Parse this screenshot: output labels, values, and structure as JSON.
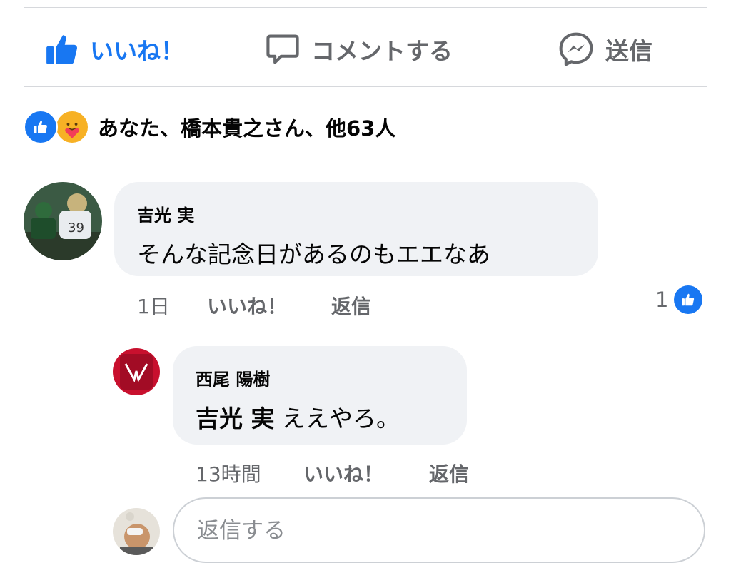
{
  "actions": {
    "like_label": "いいね！",
    "comment_label": "コメントする",
    "send_label": "送信"
  },
  "reactions": {
    "summary": "あなた、橋本貴之さん、他63人",
    "icons": [
      "like-icon",
      "care-icon"
    ]
  },
  "comments": [
    {
      "author": "吉光 実",
      "text": "そんな記念日があるのもエエなあ",
      "time": "1日",
      "like_label": "いいね！",
      "reply_label": "返信",
      "like_count": "1",
      "replies": [
        {
          "author": "西尾 陽樹",
          "mention": "吉光 実",
          "text": "ええやろ。",
          "time": "13時間",
          "like_label": "いいね！",
          "reply_label": "返信"
        }
      ]
    }
  ],
  "reply_input": {
    "placeholder": "返信する"
  },
  "colors": {
    "accent": "#1877f2",
    "muted_text": "#65676b",
    "bubble": "#f0f2f5",
    "divider": "#d6d8dc"
  }
}
